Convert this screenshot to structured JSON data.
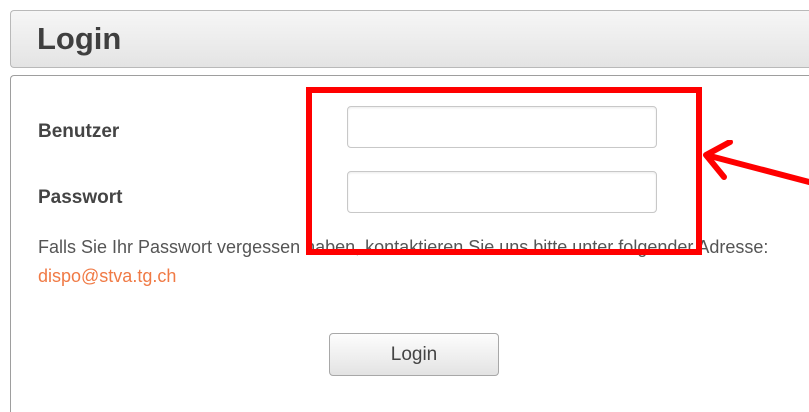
{
  "header": {
    "title": "Login"
  },
  "form": {
    "username_label": "Benutzer",
    "username_value": "",
    "password_label": "Passwort",
    "password_value": "",
    "hint_text": "Falls Sie Ihr Passwort vergessen haben, kontaktieren Sie uns bitte unter folgender Adresse: ",
    "hint_email": "dispo@stva.tg.ch",
    "login_button_label": "Login"
  },
  "annotation": {
    "highlight_color": "#ff0000"
  },
  "colors": {
    "link": "#f07a45",
    "text": "#444444"
  }
}
